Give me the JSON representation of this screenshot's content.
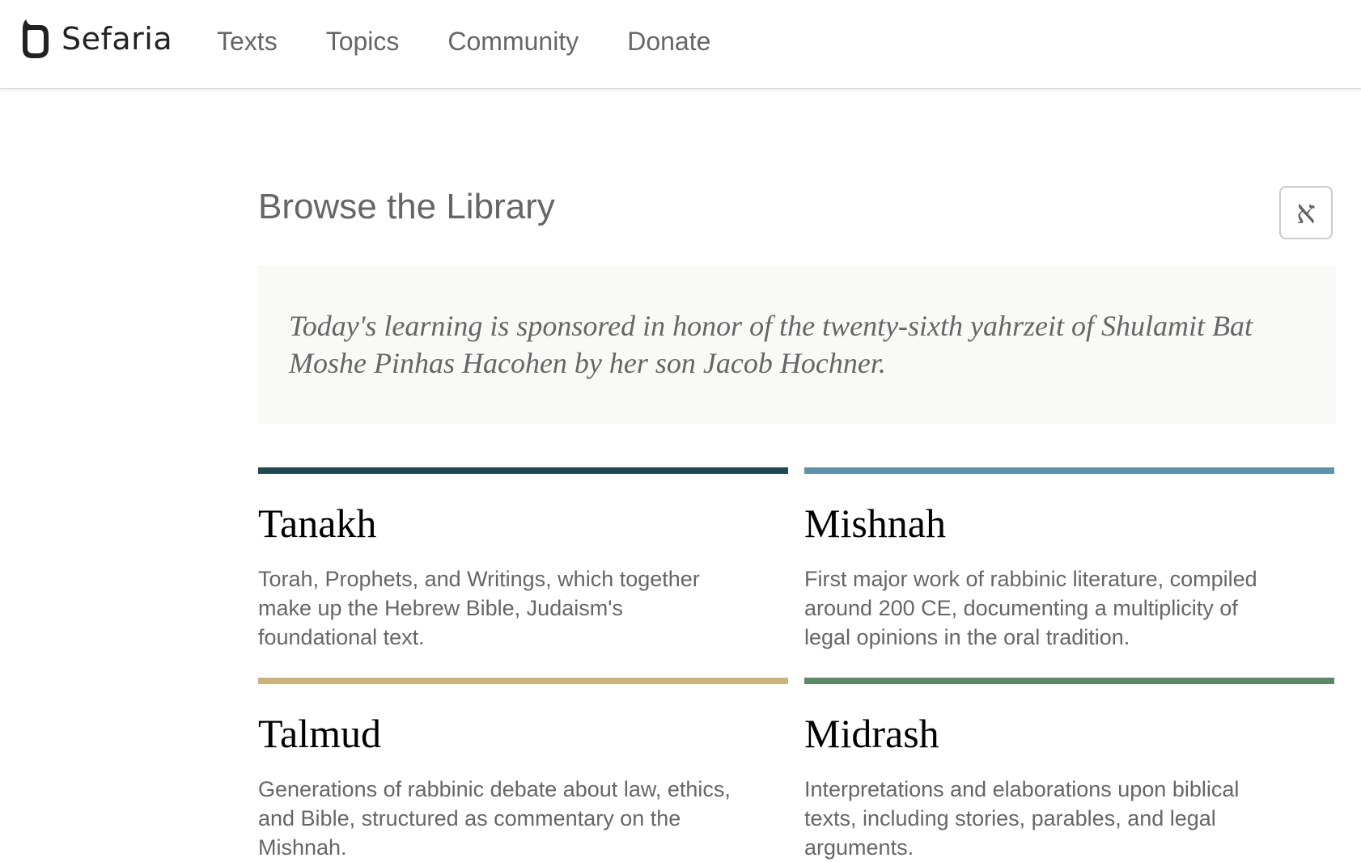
{
  "header": {
    "logo_text": "Sefaria",
    "nav": [
      {
        "label": "Texts"
      },
      {
        "label": "Topics"
      },
      {
        "label": "Community"
      },
      {
        "label": "Donate"
      }
    ]
  },
  "main": {
    "title": "Browse the Library",
    "language_toggle": "א",
    "sponsor_text": "Today's learning is sponsored in honor of the twenty-sixth yahrzeit of Shulamit Bat Moshe Pinhas Hacohen by her son Jacob Hochner.",
    "categories": [
      {
        "title": "Tanakh",
        "description": "Torah, Prophets, and Writings, which together make up the Hebrew Bible, Judaism's foundational text.",
        "color": "#1c4a54"
      },
      {
        "title": "Mishnah",
        "description": "First major work of rabbinic literature, compiled around 200 CE, documenting a multiplicity of legal opinions in the oral tradition.",
        "color": "#5d93ae"
      },
      {
        "title": "Talmud",
        "description": "Generations of rabbinic debate about law, ethics, and Bible, structured as commentary on the Mishnah.",
        "color": "#ccb479"
      },
      {
        "title": "Midrash",
        "description": "Interpretations and elaborations upon biblical texts, including stories, parables, and legal arguments.",
        "color": "#5c8a66"
      }
    ]
  }
}
